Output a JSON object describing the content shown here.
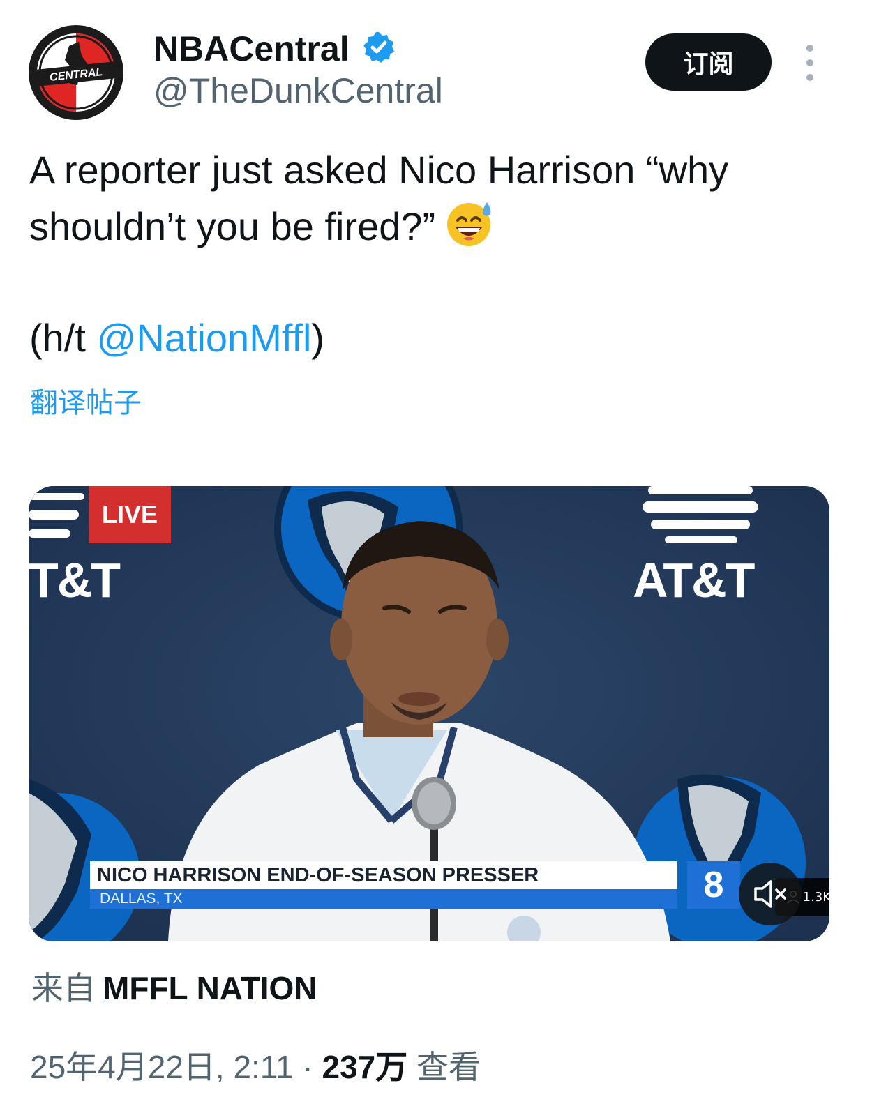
{
  "author": {
    "display_name": "NBACentral",
    "handle": "@TheDunkCentral",
    "avatar_text": "CENTRAL",
    "verified": true
  },
  "actions": {
    "subscribe_label": "订阅",
    "more_icon": "more-vertical-icon"
  },
  "tweet": {
    "line1": "A reporter just asked Nico Harrison “why",
    "line2": "shouldn’t you be fired?”",
    "emoji": "grinning-face-with-sweat",
    "credit_prefix": "(h/t ",
    "credit_mention": "@NationMffl",
    "credit_suffix": ")",
    "translate_label": "翻译帖子"
  },
  "media": {
    "live_label": "LIVE",
    "sponsor_left": "T&T",
    "sponsor_right": "AT&T",
    "lower_third_title": "NICO HARRISON END-OF-SEASON PRESSER",
    "lower_third_subtitle": "DALLAS, TX",
    "station_label": "8",
    "viewer_count": "1.3K",
    "mute_icon": "speaker-muted-icon",
    "colors": {
      "backdrop": "#233a5a",
      "live": "#d32f2f",
      "banner": "#1e6fd6"
    }
  },
  "source": {
    "prefix": "来自",
    "name": "MFFL NATION"
  },
  "meta": {
    "timestamp": "25年4月22日, 2:11",
    "separator": " · ",
    "views_count": "237万",
    "views_label": " 查看"
  },
  "colors": {
    "link": "#1d9bf0",
    "text": "#0f1419",
    "secondary": "#536471",
    "button_bg": "#0f1419"
  }
}
